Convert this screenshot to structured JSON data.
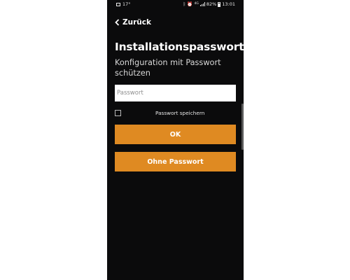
{
  "status_bar": {
    "temperature": "17°",
    "battery_percent": "82%",
    "time": "13:01",
    "icons": [
      "gallery-icon",
      "bluetooth-icon",
      "alarm-icon",
      "network-icon",
      "signal-icon",
      "battery-icon"
    ]
  },
  "header": {
    "back_label": "Zurück"
  },
  "main": {
    "title": "Installationspasswort",
    "subtitle": "Konfiguration mit Passwort schützen",
    "password_field": {
      "value": "",
      "placeholder": "Passwort"
    },
    "save_password": {
      "label": "Passwort speichern",
      "checked": false
    },
    "ok_label": "OK",
    "no_password_label": "Ohne Passwort"
  },
  "colors": {
    "background": "#0b0b0c",
    "accent": "#df8a22",
    "text": "#ffffff"
  }
}
